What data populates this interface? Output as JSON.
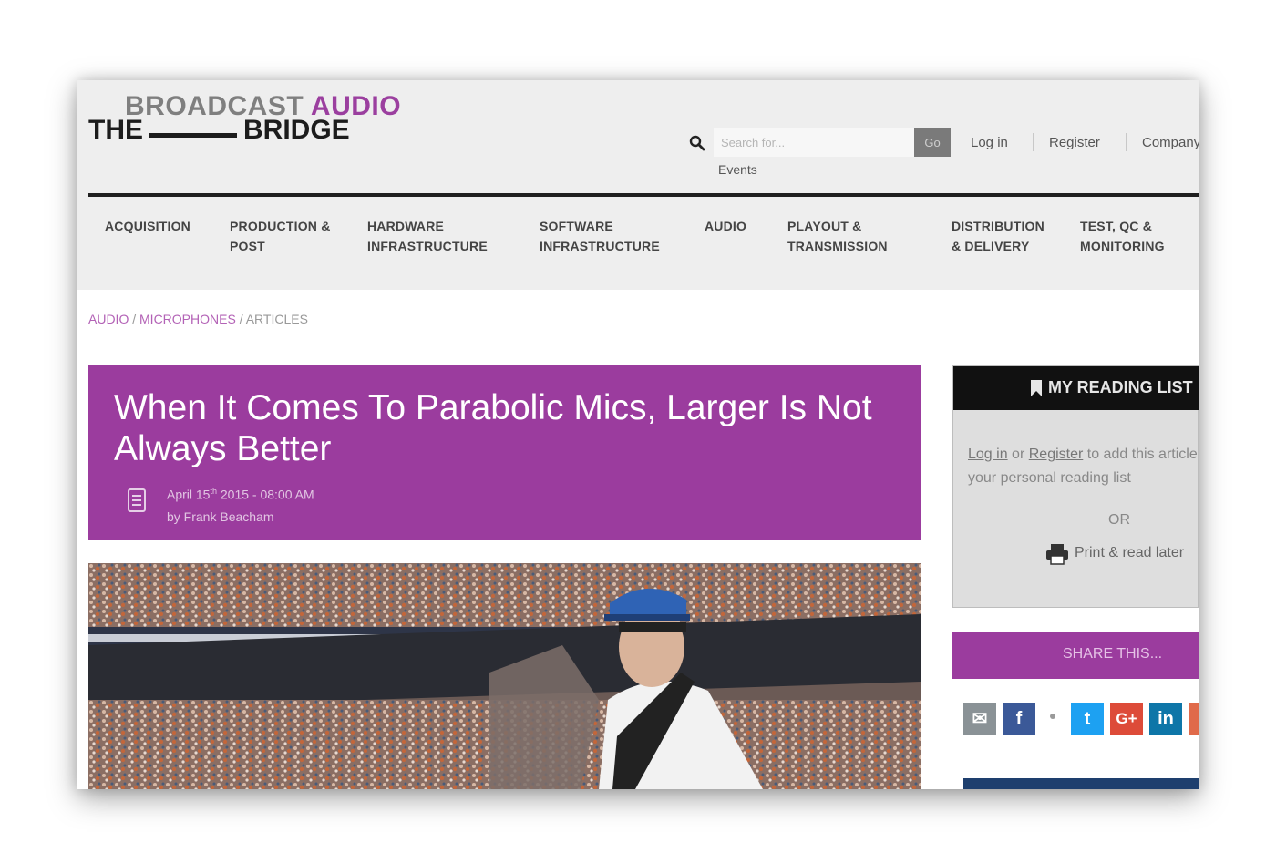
{
  "logo": {
    "line1_grey": "BROADCAST",
    "line1_purple": "AUDIO",
    "line2_left": "THE",
    "line2_right": "BRIDGE"
  },
  "search": {
    "placeholder": "Search for...",
    "button": "Go",
    "icon": "search-icon"
  },
  "top_links": {
    "login": "Log in",
    "register": "Register",
    "company": "Company",
    "events": "Events"
  },
  "nav": [
    {
      "line1": "ACQUISITION",
      "line2": ""
    },
    {
      "line1": "PRODUCTION &",
      "line2": "POST"
    },
    {
      "line1": "HARDWARE",
      "line2": "INFRASTRUCTURE"
    },
    {
      "line1": "SOFTWARE",
      "line2": "INFRASTRUCTURE"
    },
    {
      "line1": "AUDIO",
      "line2": ""
    },
    {
      "line1": "PLAYOUT &",
      "line2": "TRANSMISSION"
    },
    {
      "line1": "DISTRIBUTION",
      "line2": "& DELIVERY"
    },
    {
      "line1": "TEST, QC &",
      "line2": "MONITORING"
    }
  ],
  "breadcrumb": {
    "item1": "AUDIO",
    "item2": "MICROPHONES",
    "item3": "ARTICLES",
    "separator": " / "
  },
  "article": {
    "title": "When It Comes To Parabolic Mics, Larger Is Not Always Better",
    "date_prefix": "April 15",
    "date_sup": "th",
    "date_suffix": " 2015 - 08:00 AM",
    "author": "by Frank Beacham"
  },
  "sidebar": {
    "reading_list_title": "MY READING LIST",
    "login_link": "Log in",
    "or_word": "or",
    "register_link": "Register",
    "line1_rest": "to add this article to",
    "line2": "your personal reading list",
    "or_divider": "OR",
    "print_label": "Print & read later",
    "share_label": "SHARE THIS..."
  },
  "social": [
    {
      "name": "email",
      "glyph": "✉",
      "color": "#8a9296"
    },
    {
      "name": "facebook",
      "glyph": "f",
      "color": "#3b5998"
    },
    {
      "name": "twitter",
      "glyph": "t",
      "color": "#1da1f2"
    },
    {
      "name": "google-plus",
      "glyph": "G+",
      "color": "#dd4b39"
    },
    {
      "name": "linkedin",
      "glyph": "in",
      "color": "#0e76a8"
    }
  ],
  "colors": {
    "accent": "#9b3c9e",
    "nav_rule": "#1f1f1f",
    "header_bg": "#eeeeee"
  }
}
